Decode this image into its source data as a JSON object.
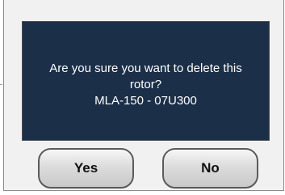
{
  "dialog": {
    "message_lines": [
      "Are you sure you want to delete this",
      "rotor?",
      "MLA-150 - 07U300"
    ],
    "yes_label": "Yes",
    "no_label": "No"
  },
  "colors": {
    "panel_background": "#1c2f48",
    "dialog_background": "#f1f1f1",
    "text": "#ffffff"
  }
}
